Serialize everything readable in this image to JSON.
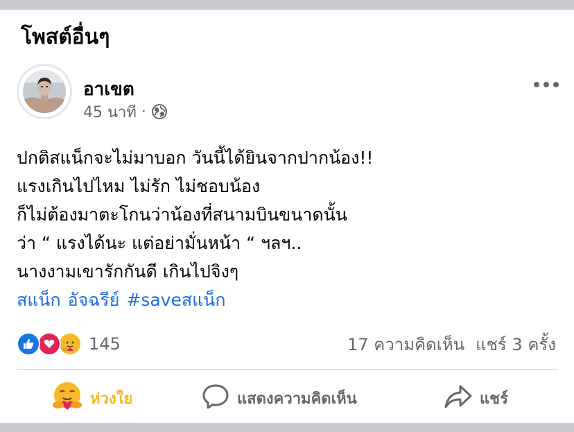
{
  "section_title": "โพสต์อื่นๆ",
  "post": {
    "author": "อาเขต",
    "time": "45 นาที",
    "separator": "·",
    "privacy_icon": "globe-icon",
    "menu_icon": "more-horizontal-icon",
    "lines": [
      "ปกติสแน็กจะไม่มาบอก วันนี้ได้ยินจากปากน้อง!!",
      "แรงเกินไปไหม ไม่รัก ไม่ชอบน้อง",
      "ก็ไม่ต้องมาตะโกนว่าน้องที่สนามบินขนาดนั้น",
      "ว่า “ แรงได้นะ แต่อย่ามั่นหน้า “  ฯลฯ..",
      "นางงามเขารักกันดี เกินไปจิงๆ"
    ],
    "tags": [
      "สแน็ก",
      "อัจฉรีย์",
      "#saveสแน็ก"
    ]
  },
  "reactions": {
    "types": [
      "like",
      "love",
      "care"
    ],
    "count": "145"
  },
  "stats": {
    "comments": "17 ความคิดเห็น",
    "shares": "แชร์ 3 ครั้ง"
  },
  "actions": {
    "care": "ห่วงใย",
    "comment": "แสดงความคิดเห็น",
    "share": "แชร์"
  },
  "colors": {
    "like_blue": "#1b74e4",
    "love_red": "#e0245e",
    "care_yellow": "#f7b928",
    "hashtag_blue": "#216fdb",
    "secondary_text": "#65676b"
  }
}
